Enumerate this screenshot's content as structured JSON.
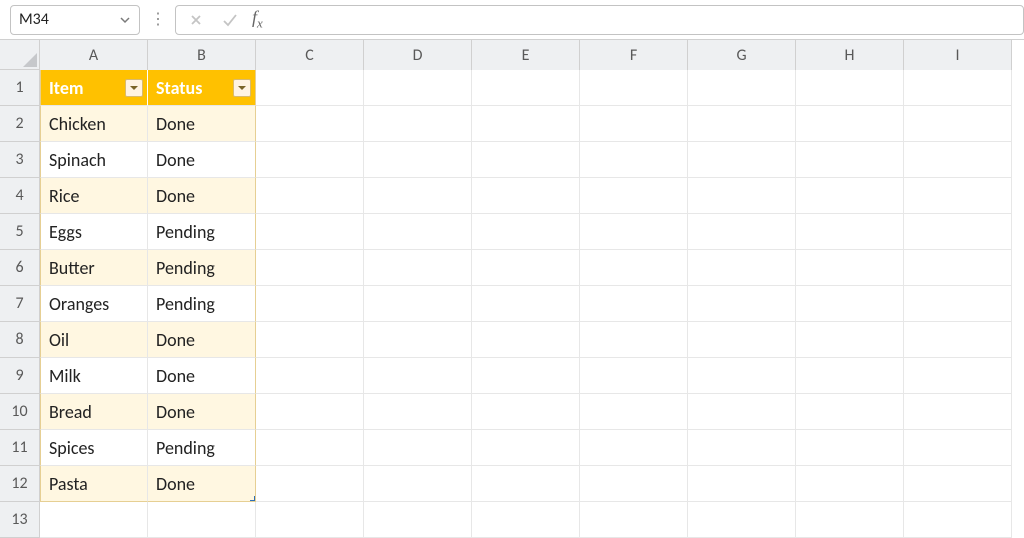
{
  "nameBox": {
    "value": "M34"
  },
  "formulaBar": {
    "value": ""
  },
  "columns": [
    "A",
    "B",
    "C",
    "D",
    "E",
    "F",
    "G",
    "H",
    "I"
  ],
  "rowNumbers": [
    "1",
    "2",
    "3",
    "4",
    "5",
    "6",
    "7",
    "8",
    "9",
    "10",
    "11",
    "12",
    "13"
  ],
  "table": {
    "headers": [
      "Item",
      "Status"
    ],
    "rows": [
      {
        "item": "Chicken",
        "status": "Done"
      },
      {
        "item": "Spinach",
        "status": "Done"
      },
      {
        "item": "Rice",
        "status": "Done"
      },
      {
        "item": "Eggs",
        "status": "Pending"
      },
      {
        "item": "Butter",
        "status": "Pending"
      },
      {
        "item": "Oranges",
        "status": "Pending"
      },
      {
        "item": "Oil",
        "status": "Done"
      },
      {
        "item": "Milk",
        "status": "Done"
      },
      {
        "item": "Bread",
        "status": "Done"
      },
      {
        "item": "Spices",
        "status": "Pending"
      },
      {
        "item": "Pasta",
        "status": "Done"
      }
    ]
  },
  "colors": {
    "tableHeaderBg": "#ffc100",
    "tableHeaderText": "#ffffff",
    "bandA": "#fff7e1",
    "bandB": "#ffffff"
  }
}
